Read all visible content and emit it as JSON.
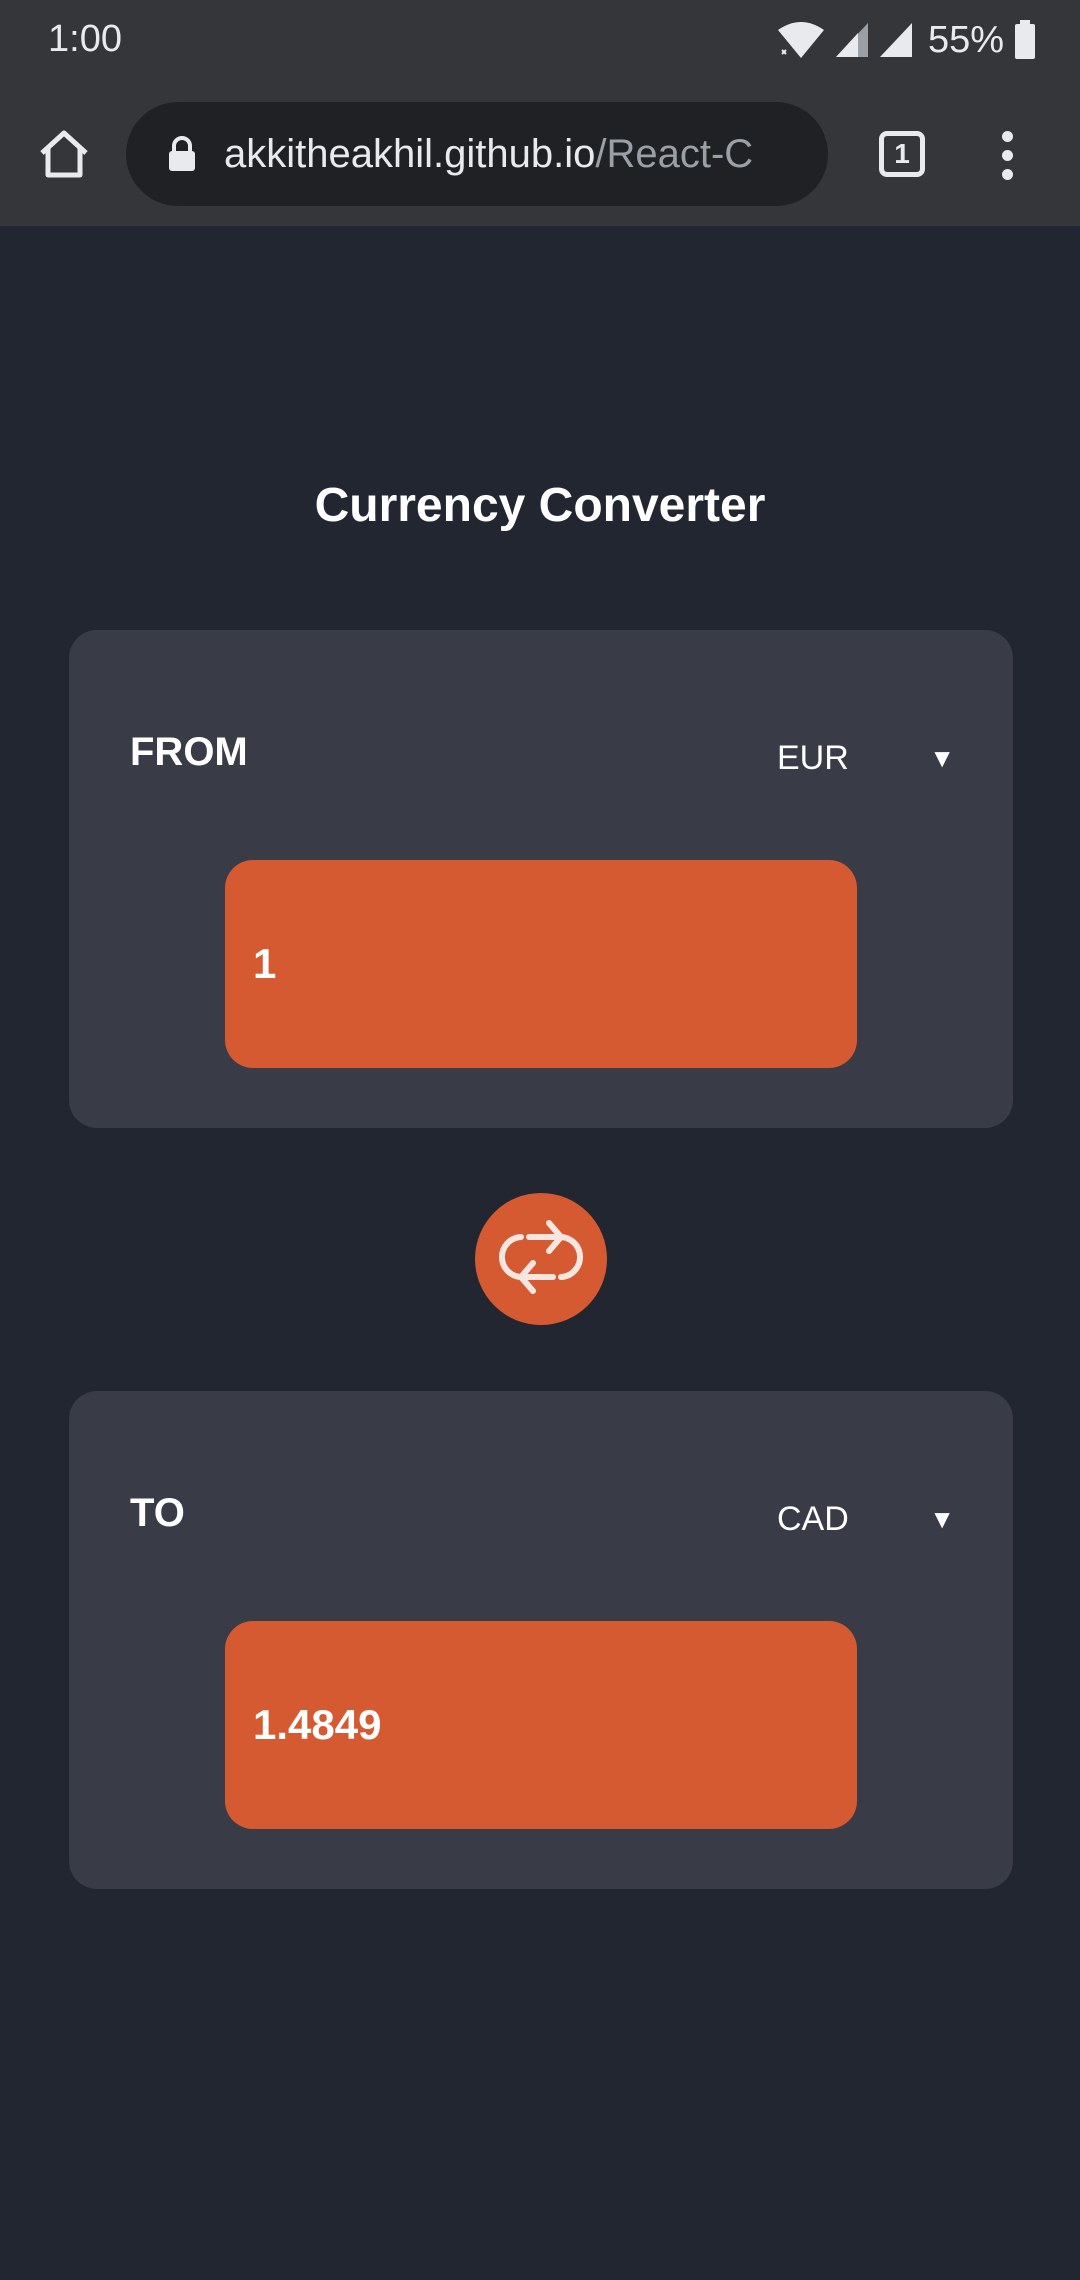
{
  "status_bar": {
    "time": "1:00",
    "battery": "55%",
    "icons": [
      "wifi-icon",
      "signal-icon",
      "signal-icon",
      "battery-icon"
    ]
  },
  "browser": {
    "url_domain": "akkitheakhil.github.io",
    "url_path": "/React-C",
    "tab_count": "1",
    "icons": [
      "home-icon",
      "lock-icon",
      "tabs-icon",
      "more-vert-icon"
    ]
  },
  "app": {
    "title": "Currency Converter",
    "from": {
      "label": "FROM",
      "currency": "EUR",
      "amount": "1"
    },
    "to": {
      "label": "TO",
      "currency": "CAD",
      "amount": "1.4849"
    },
    "swap_icon": "swap-icon",
    "colors": {
      "background": "#222630",
      "card": "#393c46",
      "accent": "#d55a32"
    }
  }
}
